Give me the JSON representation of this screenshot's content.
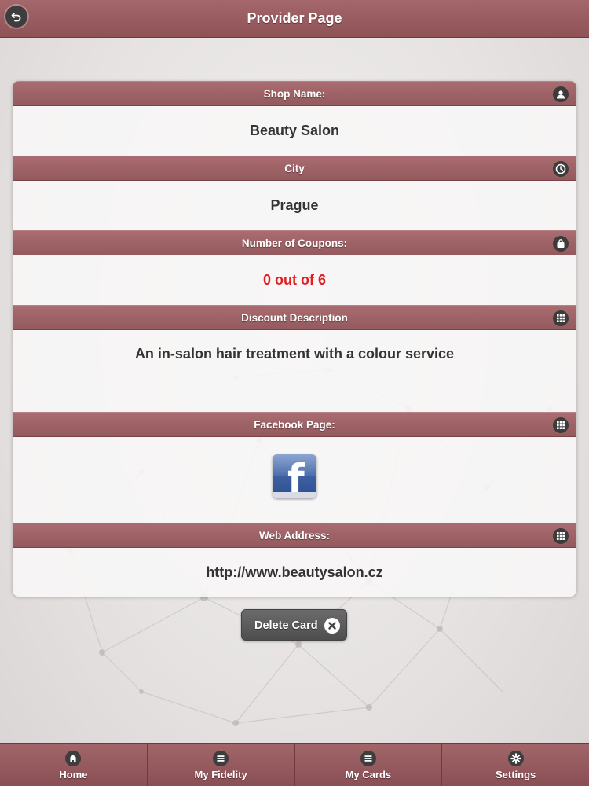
{
  "header": {
    "title": "Provider Page",
    "back_icon": "back-arrow-icon"
  },
  "sections": [
    {
      "label": "Shop Name:",
      "icon": "user-icon",
      "value": "Beauty Salon"
    },
    {
      "label": "City",
      "icon": "clock-icon",
      "value": "Prague"
    },
    {
      "label": "Number of Coupons:",
      "icon": "shopping-bag-icon",
      "value": "0 out of 6"
    },
    {
      "label": "Discount Description",
      "icon": "grid-icon",
      "value": "An in-salon hair treatment with a colour service"
    },
    {
      "label": "Facebook Page:",
      "icon": "grid-icon",
      "logo": "facebook-logo",
      "logo_letter": "f"
    },
    {
      "label": "Web Address:",
      "icon": "grid-icon",
      "value": "http://www.beautysalon.cz"
    }
  ],
  "actions": {
    "delete_label": "Delete Card",
    "delete_icon": "close-icon"
  },
  "footer": {
    "items": [
      {
        "label": "Home",
        "icon": "home-icon"
      },
      {
        "label": "My Fidelity",
        "icon": "menu-icon"
      },
      {
        "label": "My Cards",
        "icon": "menu-icon"
      },
      {
        "label": "Settings",
        "icon": "gear-icon"
      }
    ]
  },
  "colors": {
    "header_bg": "#97595e",
    "section_header_bg": "#a0656a",
    "coupon_value": "#e41e1e",
    "icon_bg": "#3b3b3b",
    "delete_button_bg": "#5a5a5a"
  }
}
